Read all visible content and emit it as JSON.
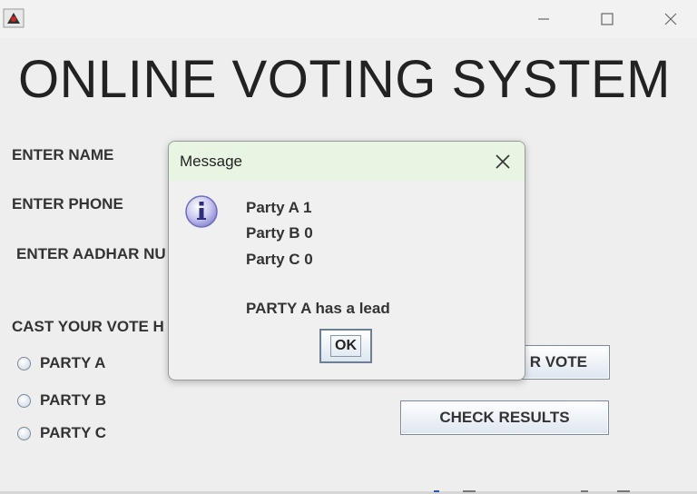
{
  "window": {
    "title_icon": "java-duke-icon",
    "controls": [
      "minimize-icon",
      "maximize-icon",
      "close-icon"
    ]
  },
  "header": {
    "title": "ONLINE VOTING SYSTEM"
  },
  "form": {
    "name_label": "ENTER NAME",
    "phone_label": "ENTER PHONE",
    "aadhar_label": "ENTER AADHAR NU",
    "vote_prompt": "CAST YOUR VOTE H",
    "options": [
      {
        "label": "PARTY A",
        "selected": false
      },
      {
        "label": "PARTY B",
        "selected": false
      },
      {
        "label": "PARTY C",
        "selected": false
      }
    ],
    "vote_button_visible_label": "R VOTE",
    "check_results_label": "CHECK RESULTS"
  },
  "dialog": {
    "title": "Message",
    "icon": "info-icon",
    "lines": [
      "Party A 1",
      "Party B 0",
      "Party C 0"
    ],
    "result_line": "PARTY A has a lead",
    "ok_label": "OK"
  }
}
